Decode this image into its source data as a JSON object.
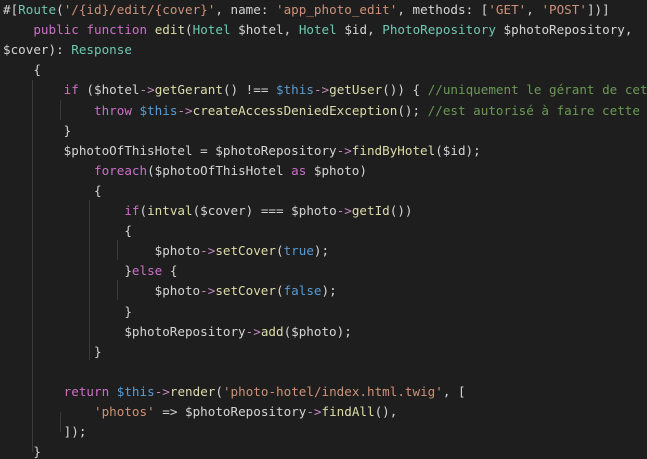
{
  "editor": {
    "language": "php",
    "token_colors": {
      "default": "#d4d4d4",
      "keyword": "#cc6fc6",
      "class": "#6ec8b0",
      "function": "#dcdcaa",
      "string": "#ce9178",
      "comment": "#6a9955",
      "constant": "#569cd6",
      "arrow": "#c586c0",
      "parameter": "#9cdcfe"
    },
    "lines": [
      {
        "tokens": [
          {
            "t": "#[",
            "c": "default"
          },
          {
            "t": "Route",
            "c": "class"
          },
          {
            "t": "(",
            "c": "default"
          },
          {
            "t": "'/{id}/edit/{cover}'",
            "c": "string"
          },
          {
            "t": ", name: ",
            "c": "default"
          },
          {
            "t": "'app_photo_edit'",
            "c": "string"
          },
          {
            "t": ", methods: [",
            "c": "default"
          },
          {
            "t": "'GET'",
            "c": "string"
          },
          {
            "t": ", ",
            "c": "default"
          },
          {
            "t": "'POST'",
            "c": "string"
          },
          {
            "t": "])]",
            "c": "default"
          }
        ]
      },
      {
        "tokens": [
          {
            "t": "    ",
            "c": "default"
          },
          {
            "t": "public",
            "c": "keyword"
          },
          {
            "t": " ",
            "c": "default"
          },
          {
            "t": "function",
            "c": "keyword"
          },
          {
            "t": " ",
            "c": "default"
          },
          {
            "t": "edit",
            "c": "function"
          },
          {
            "t": "(",
            "c": "default"
          },
          {
            "t": "Hotel",
            "c": "class"
          },
          {
            "t": " $hotel, ",
            "c": "default"
          },
          {
            "t": "Hotel",
            "c": "class"
          },
          {
            "t": " $id, ",
            "c": "default"
          },
          {
            "t": "PhotoRepository",
            "c": "class"
          },
          {
            "t": " $photoRepository,",
            "c": "default"
          }
        ]
      },
      {
        "tokens": [
          {
            "t": "$cover): ",
            "c": "default"
          },
          {
            "t": "Response",
            "c": "class"
          }
        ]
      },
      {
        "tokens": [
          {
            "t": "    {",
            "c": "default"
          }
        ]
      },
      {
        "tokens": [
          {
            "t": "        ",
            "c": "default"
          },
          {
            "t": "if",
            "c": "keyword"
          },
          {
            "t": " ($hotel",
            "c": "default"
          },
          {
            "t": "->",
            "c": "arrow"
          },
          {
            "t": "getGerant",
            "c": "function"
          },
          {
            "t": "() !== ",
            "c": "default"
          },
          {
            "t": "$this",
            "c": "const"
          },
          {
            "t": "->",
            "c": "arrow"
          },
          {
            "t": "getUser",
            "c": "function"
          },
          {
            "t": "()) { ",
            "c": "default"
          },
          {
            "t": "//uniquement le gérant de cet hôtel",
            "c": "comment"
          }
        ]
      },
      {
        "tokens": [
          {
            "t": "            ",
            "c": "default"
          },
          {
            "t": "throw",
            "c": "keyword"
          },
          {
            "t": " ",
            "c": "default"
          },
          {
            "t": "$this",
            "c": "const"
          },
          {
            "t": "->",
            "c": "arrow"
          },
          {
            "t": "createAccessDeniedException",
            "c": "function"
          },
          {
            "t": "(); ",
            "c": "default"
          },
          {
            "t": "//est autorisé à faire cette action",
            "c": "comment"
          }
        ]
      },
      {
        "tokens": [
          {
            "t": "        }",
            "c": "default"
          }
        ]
      },
      {
        "tokens": [
          {
            "t": "        $photoOfThisHotel = $photoRepository",
            "c": "default"
          },
          {
            "t": "->",
            "c": "arrow"
          },
          {
            "t": "findByHotel",
            "c": "function"
          },
          {
            "t": "($id);",
            "c": "default"
          }
        ]
      },
      {
        "tokens": [
          {
            "t": "            ",
            "c": "default"
          },
          {
            "t": "foreach",
            "c": "keyword"
          },
          {
            "t": "($photoOfThisHotel ",
            "c": "default"
          },
          {
            "t": "as",
            "c": "keyword"
          },
          {
            "t": " $photo)",
            "c": "default"
          }
        ]
      },
      {
        "tokens": [
          {
            "t": "            {",
            "c": "default"
          }
        ]
      },
      {
        "tokens": [
          {
            "t": "                ",
            "c": "default"
          },
          {
            "t": "if",
            "c": "keyword"
          },
          {
            "t": "(",
            "c": "default"
          },
          {
            "t": "intval",
            "c": "function"
          },
          {
            "t": "($cover) === $photo",
            "c": "default"
          },
          {
            "t": "->",
            "c": "arrow"
          },
          {
            "t": "getId",
            "c": "function"
          },
          {
            "t": "())",
            "c": "default"
          }
        ]
      },
      {
        "tokens": [
          {
            "t": "                {",
            "c": "default"
          }
        ]
      },
      {
        "tokens": [
          {
            "t": "                    $photo",
            "c": "default"
          },
          {
            "t": "->",
            "c": "arrow"
          },
          {
            "t": "setCover",
            "c": "function"
          },
          {
            "t": "(",
            "c": "default"
          },
          {
            "t": "true",
            "c": "const"
          },
          {
            "t": ");",
            "c": "default"
          }
        ]
      },
      {
        "tokens": [
          {
            "t": "                }",
            "c": "default"
          },
          {
            "t": "else",
            "c": "keyword"
          },
          {
            "t": " {",
            "c": "default"
          }
        ]
      },
      {
        "tokens": [
          {
            "t": "                    $photo",
            "c": "default"
          },
          {
            "t": "->",
            "c": "arrow"
          },
          {
            "t": "setCover",
            "c": "function"
          },
          {
            "t": "(",
            "c": "default"
          },
          {
            "t": "false",
            "c": "const"
          },
          {
            "t": ");",
            "c": "default"
          }
        ]
      },
      {
        "tokens": [
          {
            "t": "                }",
            "c": "default"
          }
        ]
      },
      {
        "tokens": [
          {
            "t": "                $photoRepository",
            "c": "default"
          },
          {
            "t": "->",
            "c": "arrow"
          },
          {
            "t": "add",
            "c": "function"
          },
          {
            "t": "($photo);",
            "c": "default"
          }
        ]
      },
      {
        "tokens": [
          {
            "t": "            }",
            "c": "default"
          }
        ]
      },
      {
        "tokens": []
      },
      {
        "tokens": [
          {
            "t": "        ",
            "c": "default"
          },
          {
            "t": "return",
            "c": "keyword"
          },
          {
            "t": " ",
            "c": "default"
          },
          {
            "t": "$this",
            "c": "const"
          },
          {
            "t": "->",
            "c": "arrow"
          },
          {
            "t": "render",
            "c": "function"
          },
          {
            "t": "(",
            "c": "default"
          },
          {
            "t": "'photo-hotel/index.html.twig'",
            "c": "string"
          },
          {
            "t": ", [",
            "c": "default"
          }
        ]
      },
      {
        "tokens": [
          {
            "t": "            ",
            "c": "default"
          },
          {
            "t": "'photos'",
            "c": "string"
          },
          {
            "t": " => $photoRepository",
            "c": "default"
          },
          {
            "t": "->",
            "c": "arrow"
          },
          {
            "t": "findAll",
            "c": "function"
          },
          {
            "t": "(),",
            "c": "default"
          }
        ]
      },
      {
        "tokens": [
          {
            "t": "        ]);",
            "c": "default"
          }
        ]
      },
      {
        "tokens": [
          {
            "t": "    }",
            "c": "default"
          }
        ]
      }
    ]
  }
}
